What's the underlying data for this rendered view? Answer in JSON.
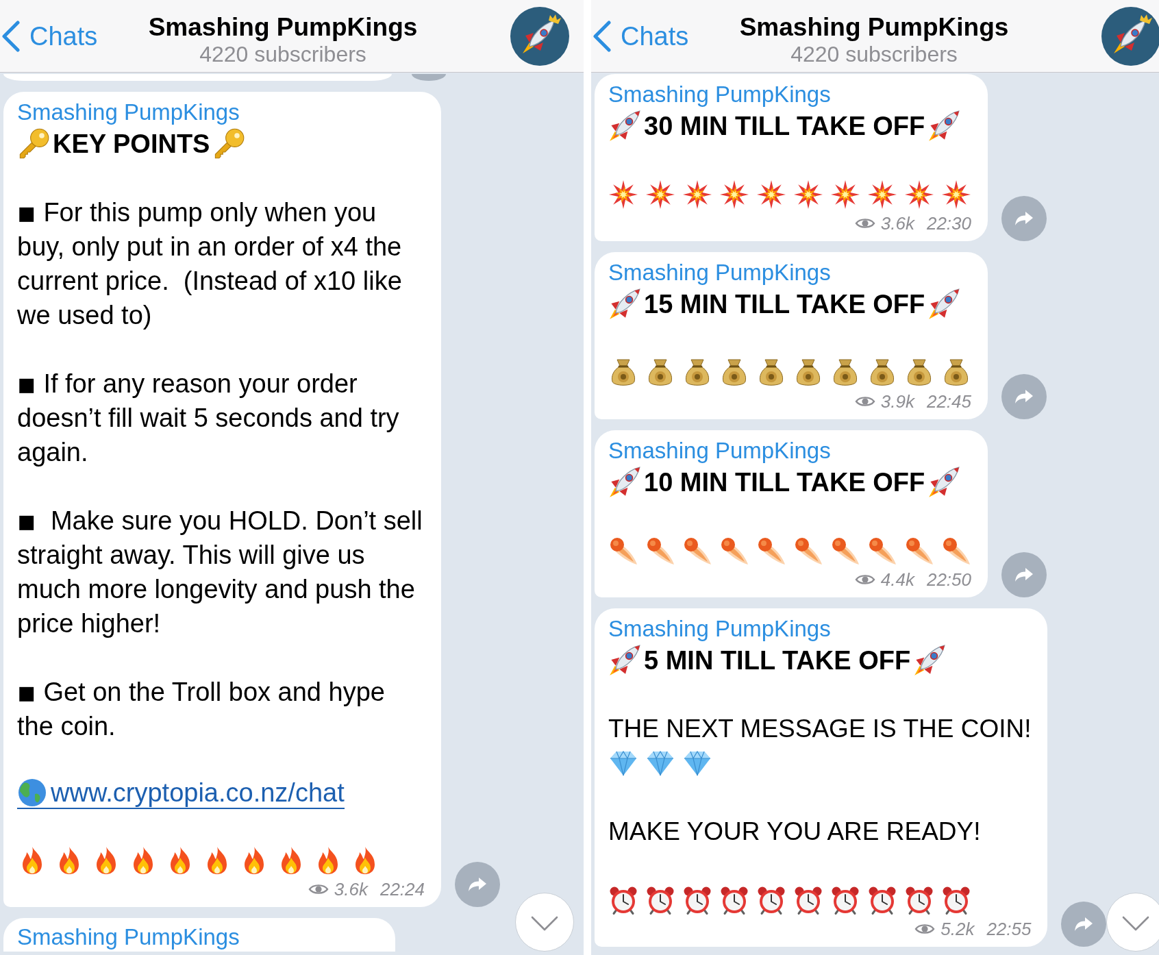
{
  "screens": [
    {
      "header": {
        "back_label": "Chats",
        "title": "Smashing PumpKings",
        "subtitle": "4220 subscribers"
      },
      "cut_off_above": true,
      "messages": [
        {
          "sender": "Smashing PumpKings",
          "forward_button": true,
          "views": "3.6k",
          "time": "22:24",
          "blocks": [
            {
              "kind": "title",
              "emoji": {
                "kind": "key"
              },
              "text": "KEY POINTS"
            },
            {
              "kind": "bullet",
              "text": "◾ For this pump only when you buy, only put in an order of x4 the current price.  (Instead of x10 like we used to)"
            },
            {
              "kind": "bullet",
              "text": "◾ If for any reason your order doesn’t fill wait 5 seconds and try again."
            },
            {
              "kind": "bullet",
              "text": "◾  Make sure you HOLD. Don’t sell straight away. This will give us much more longevity and push the price higher!"
            },
            {
              "kind": "bullet",
              "text": "◾ Get on the Troll box and hype the coin."
            },
            {
              "kind": "link",
              "emoji": {
                "kind": "globe"
              },
              "text": "www.cryptopia.co.nz/chat"
            },
            {
              "kind": "emoji_row",
              "emojis": [
                {
                  "kind": "fire"
                },
                {
                  "kind": "fire"
                },
                {
                  "kind": "fire"
                },
                {
                  "kind": "fire"
                },
                {
                  "kind": "fire"
                },
                {
                  "kind": "fire"
                },
                {
                  "kind": "fire"
                },
                {
                  "kind": "fire"
                },
                {
                  "kind": "fire"
                },
                {
                  "kind": "fire"
                }
              ]
            }
          ]
        },
        {
          "sender": "Smashing PumpKings",
          "forward_button": false
        }
      ],
      "scroll_down_button": true
    },
    {
      "header": {
        "back_label": "Chats",
        "title": "Smashing PumpKings",
        "subtitle": "4220 subscribers"
      },
      "messages": [
        {
          "sender": "Smashing PumpKings",
          "forward_button": true,
          "views": "3.6k",
          "time": "22:30",
          "blocks": [
            {
              "kind": "title",
              "emoji": {
                "kind": "rocket"
              },
              "text": "30 MIN TILL TAKE OFF"
            },
            {
              "kind": "emoji_row",
              "emojis": [
                {
                  "kind": "explosion"
                },
                {
                  "kind": "explosion"
                },
                {
                  "kind": "explosion"
                },
                {
                  "kind": "explosion"
                },
                {
                  "kind": "explosion"
                },
                {
                  "kind": "explosion"
                },
                {
                  "kind": "explosion"
                },
                {
                  "kind": "explosion"
                },
                {
                  "kind": "explosion"
                },
                {
                  "kind": "explosion"
                }
              ]
            }
          ]
        },
        {
          "sender": "Smashing PumpKings",
          "forward_button": true,
          "views": "3.9k",
          "time": "22:45",
          "blocks": [
            {
              "kind": "title",
              "emoji": {
                "kind": "rocket"
              },
              "text": "15 MIN TILL TAKE OFF"
            },
            {
              "kind": "emoji_row",
              "emojis": [
                {
                  "kind": "moneybag"
                },
                {
                  "kind": "moneybag"
                },
                {
                  "kind": "moneybag"
                },
                {
                  "kind": "moneybag"
                },
                {
                  "kind": "moneybag"
                },
                {
                  "kind": "moneybag"
                },
                {
                  "kind": "moneybag"
                },
                {
                  "kind": "moneybag"
                },
                {
                  "kind": "moneybag"
                },
                {
                  "kind": "moneybag"
                }
              ]
            }
          ]
        },
        {
          "sender": "Smashing PumpKings",
          "forward_button": true,
          "views": "4.4k",
          "time": "22:50",
          "blocks": [
            {
              "kind": "title",
              "emoji": {
                "kind": "rocket"
              },
              "text": "10 MIN TILL TAKE OFF"
            },
            {
              "kind": "emoji_row",
              "emojis": [
                {
                  "kind": "comet"
                },
                {
                  "kind": "comet"
                },
                {
                  "kind": "comet"
                },
                {
                  "kind": "comet"
                },
                {
                  "kind": "comet"
                },
                {
                  "kind": "comet"
                },
                {
                  "kind": "comet"
                },
                {
                  "kind": "comet"
                },
                {
                  "kind": "comet"
                },
                {
                  "kind": "comet"
                }
              ]
            }
          ]
        },
        {
          "sender": "Smashing PumpKings",
          "forward_button": true,
          "views": "5.2k",
          "time": "22:55",
          "blocks": [
            {
              "kind": "title",
              "emoji": {
                "kind": "rocket"
              },
              "text": "5 MIN TILL TAKE OFF"
            },
            {
              "kind": "text",
              "text": "THE NEXT MESSAGE IS THE COIN!",
              "emojis": [
                {
                  "kind": "diamond"
                },
                {
                  "kind": "diamond"
                },
                {
                  "kind": "diamond"
                }
              ]
            },
            {
              "kind": "text",
              "text": "MAKE YOUR YOU ARE READY!"
            },
            {
              "kind": "emoji_row",
              "emojis": [
                {
                  "kind": "clock"
                },
                {
                  "kind": "clock"
                },
                {
                  "kind": "clock"
                },
                {
                  "kind": "clock"
                },
                {
                  "kind": "clock"
                },
                {
                  "kind": "clock"
                },
                {
                  "kind": "clock"
                },
                {
                  "kind": "clock"
                },
                {
                  "kind": "clock"
                },
                {
                  "kind": "clock"
                }
              ]
            }
          ]
        }
      ],
      "scroll_down_button": true
    }
  ]
}
